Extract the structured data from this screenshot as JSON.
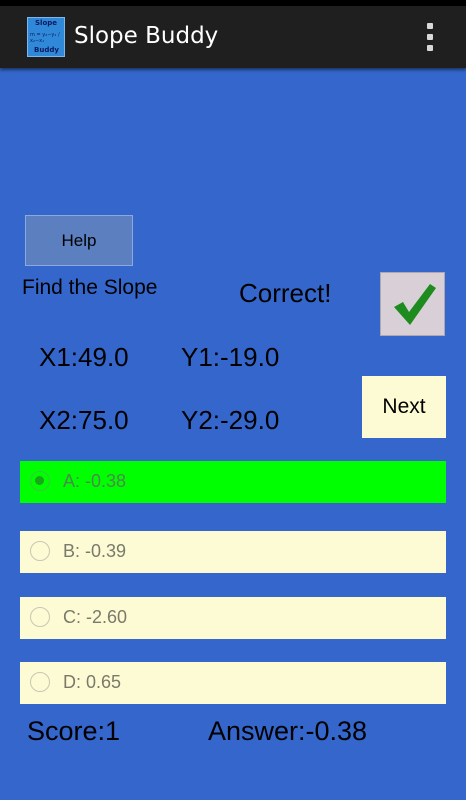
{
  "app": {
    "title": "Slope Buddy",
    "icon_text_top": "Slope",
    "icon_formula": "m = (y2 - y1) / (x2 - x1)",
    "icon_text_bottom": "Buddy"
  },
  "help_button": "Help",
  "prompt": "Find the Slope",
  "feedback": "Correct!",
  "feedback_icon": "checkmark-icon",
  "points": {
    "x1": "X1:49.0",
    "y1": "Y1:-19.0",
    "x2": "X2:75.0",
    "y2": "Y2:-29.0"
  },
  "next_button": "Next",
  "options": [
    {
      "label": "A: -0.38",
      "selected": true
    },
    {
      "label": "B: -0.39",
      "selected": false
    },
    {
      "label": "C: -2.60",
      "selected": false
    },
    {
      "label": "D: 0.65",
      "selected": false
    }
  ],
  "score": "Score:1",
  "answer": "Answer:-0.38",
  "colors": {
    "background": "#3466CC",
    "action_bar": "#1F1F1F",
    "selected_option": "#00FF00",
    "option": "#FDFBD3",
    "check": "#1E8B1E"
  }
}
